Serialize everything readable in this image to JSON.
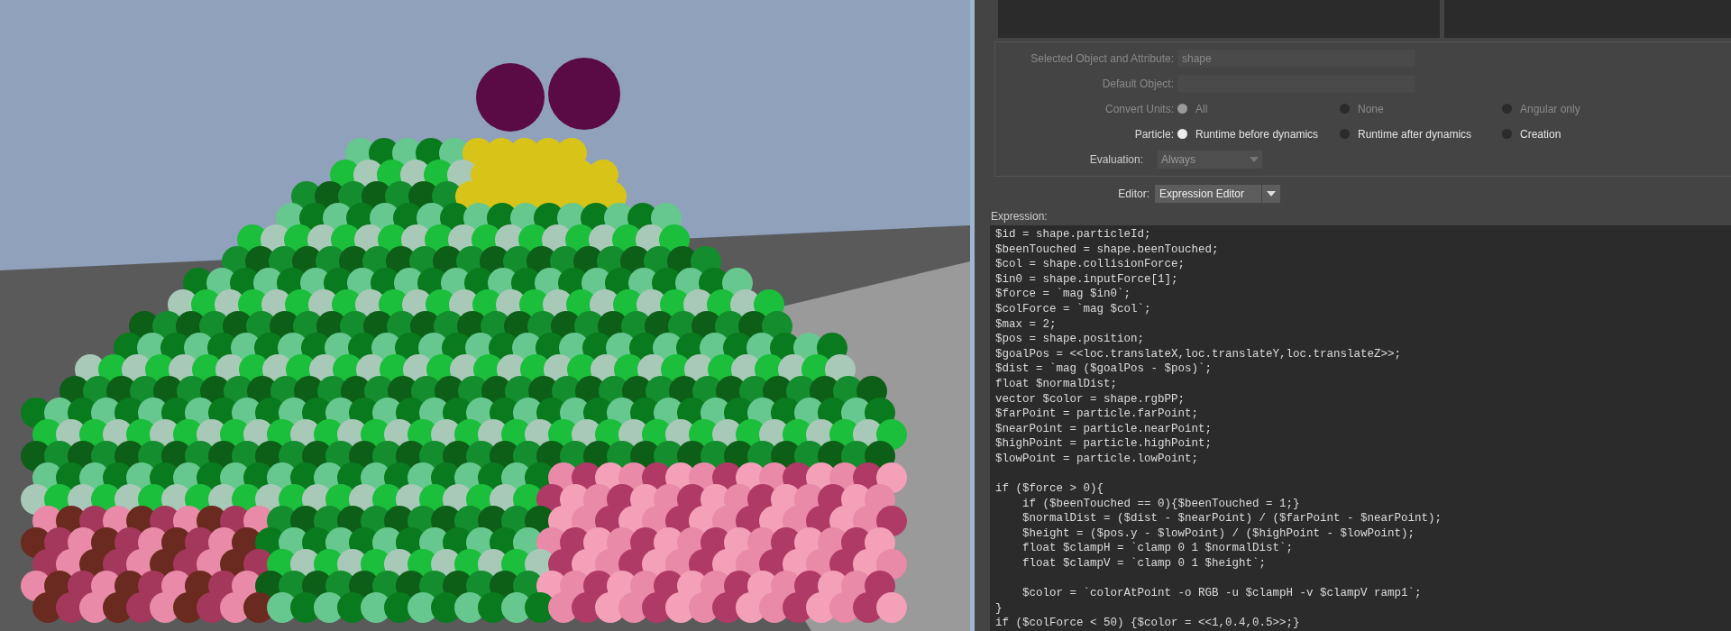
{
  "form": {
    "selected_object": {
      "label": "Selected Object and Attribute:",
      "value": "shape",
      "disabled": true
    },
    "default_object": {
      "label": "Default Object:",
      "disabled": true
    },
    "convert_units": {
      "label": "Convert Units:",
      "disabled": true,
      "options": [
        {
          "label": "All",
          "selected": true
        },
        {
          "label": "None",
          "selected": false
        },
        {
          "label": "Angular only",
          "selected": false
        }
      ]
    },
    "particle": {
      "label": "Particle:",
      "disabled": false,
      "options": [
        {
          "label": "Runtime before dynamics",
          "selected": true
        },
        {
          "label": "Runtime after dynamics",
          "selected": false
        },
        {
          "label": "Creation",
          "selected": false
        }
      ]
    },
    "evaluation": {
      "label": "Evaluation:",
      "value": "Always",
      "disabled": true
    }
  },
  "editor": {
    "label": "Editor:",
    "value": "Expression Editor"
  },
  "expression": {
    "label": "Expression:",
    "blocks": [
      [
        "$id = shape.particleId;",
        "$beenTouched = shape.beenTouched;",
        "$col = shape.collisionForce;",
        "$in0 = shape.inputForce[1];",
        "$force = `mag $in0`;",
        "$colForce = `mag $col`;",
        "$max = 2;",
        "$pos = shape.position;",
        "$goalPos = <<loc.translateX,loc.translateY,loc.translateZ>>;",
        "$dist = `mag ($goalPos - $pos)`;",
        "float $normalDist;",
        "vector $color = shape.rgbPP;",
        "$farPoint = particle.farPoint;",
        "$nearPoint = particle.nearPoint;",
        "$highPoint = particle.highPoint;",
        "$lowPoint = particle.lowPoint;"
      ],
      [
        "if ($force > 0){",
        "    if ($beenTouched == 0){$beenTouched = 1;}",
        "    $normalDist = ($dist - $nearPoint) / ($farPoint - $nearPoint);",
        "    $height = ($pos.y - $lowPoint) / ($highPoint - $lowPoint);",
        "    float $clampH = `clamp 0 1 $normalDist`;",
        "    float $clampV = `clamp 0 1 $height`;"
      ],
      [
        "    $color = `colorAtPoint -o RGB -u $clampH -v $clampV ramp1`;",
        "}",
        "if ($colForce < 50) {$color = <<1,0.4,0.5>>;}"
      ]
    ]
  }
}
